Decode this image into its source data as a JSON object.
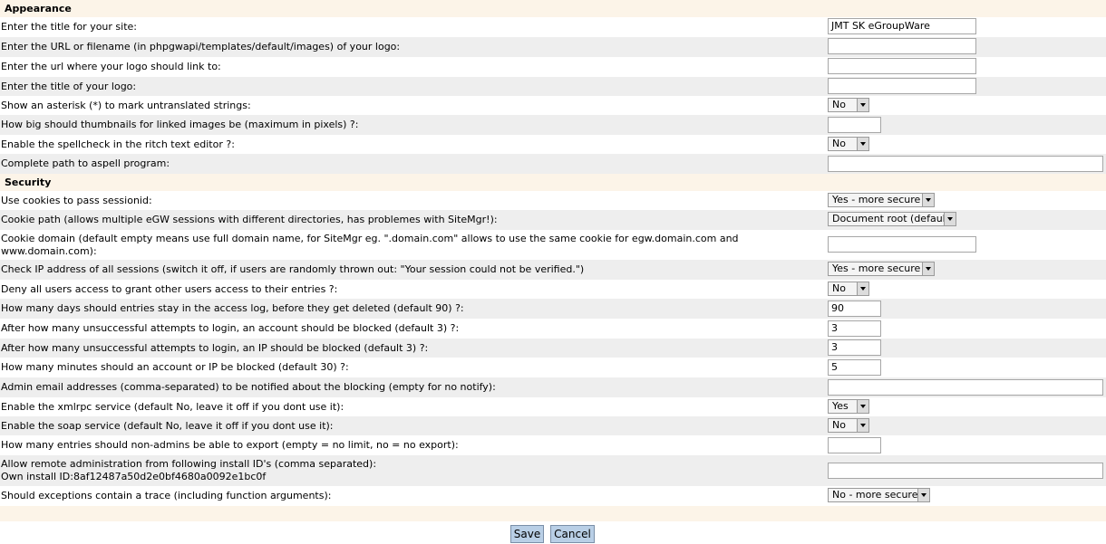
{
  "sections": {
    "appearance": "Appearance",
    "security": "Security"
  },
  "rows": {
    "site_title": {
      "label": "Enter the title for your site:",
      "value": "JMT SK eGroupWare"
    },
    "logo_url": {
      "label": "Enter the URL or filename (in phpgwapi/templates/default/images) of your logo:",
      "value": ""
    },
    "logo_link": {
      "label": "Enter the url where your logo should link to:",
      "value": ""
    },
    "logo_title": {
      "label": "Enter the title of your logo:",
      "value": ""
    },
    "asterisk": {
      "label": "Show an asterisk (*) to mark untranslated strings:",
      "value": "No"
    },
    "thumbnail": {
      "label": "How big should thumbnails for linked images be (maximum in pixels) ?:",
      "value": ""
    },
    "spellcheck": {
      "label": "Enable the spellcheck in the ritch text editor ?:",
      "value": "No"
    },
    "aspell": {
      "label": "Complete path to aspell program:",
      "value": ""
    },
    "cookies": {
      "label": "Use cookies to pass sessionid:",
      "value": "Yes - more secure"
    },
    "cookie_path": {
      "label": "Cookie path (allows multiple eGW sessions with different directories, has problemes with SiteMgr!):",
      "value": "Document root (default)"
    },
    "cookie_domain": {
      "label": "Cookie domain (default empty means use full domain name, for SiteMgr eg. \".domain.com\" allows to use the same cookie for egw.domain.com and www.domain.com):",
      "value": ""
    },
    "check_ip": {
      "label": "Check IP address of all sessions (switch it off, if users are randomly thrown out: \"Your session could not be verified.\")",
      "value": "Yes - more secure"
    },
    "deny_grant": {
      "label": "Deny all users access to grant other users access to their entries ?:",
      "value": "No"
    },
    "access_log": {
      "label": "How many days should entries stay in the access log, before they get deleted (default 90) ?:",
      "value": "90"
    },
    "account_block": {
      "label": "After how many unsuccessful attempts to login, an account should be blocked (default 3) ?:",
      "value": "3"
    },
    "ip_block": {
      "label": "After how many unsuccessful attempts to login, an IP should be blocked (default 3) ?:",
      "value": "3"
    },
    "block_minutes": {
      "label": "How many minutes should an account or IP be blocked (default 30) ?:",
      "value": "5"
    },
    "admin_email": {
      "label": "Admin email addresses (comma-separated) to be notified about the blocking (empty for no notify):",
      "value": ""
    },
    "xmlrpc": {
      "label": "Enable the xmlrpc service (default No, leave it off if you dont use it):",
      "value": "Yes"
    },
    "soap": {
      "label": "Enable the soap service (default No, leave it off if you dont use it):",
      "value": "No"
    },
    "export": {
      "label": "How many entries should non-admins be able to export (empty = no limit, no = no export):",
      "value": ""
    },
    "remote_admin": {
      "label": "Allow remote administration from following install ID's (comma separated):",
      "label2": "Own install ID:8af12487a50d2e0bf4680a0092e1bc0f",
      "value": ""
    },
    "exceptions": {
      "label": "Should exceptions contain a trace (including function arguments):",
      "value": "No - more secure"
    }
  },
  "buttons": {
    "save": "Save",
    "cancel": "Cancel"
  }
}
